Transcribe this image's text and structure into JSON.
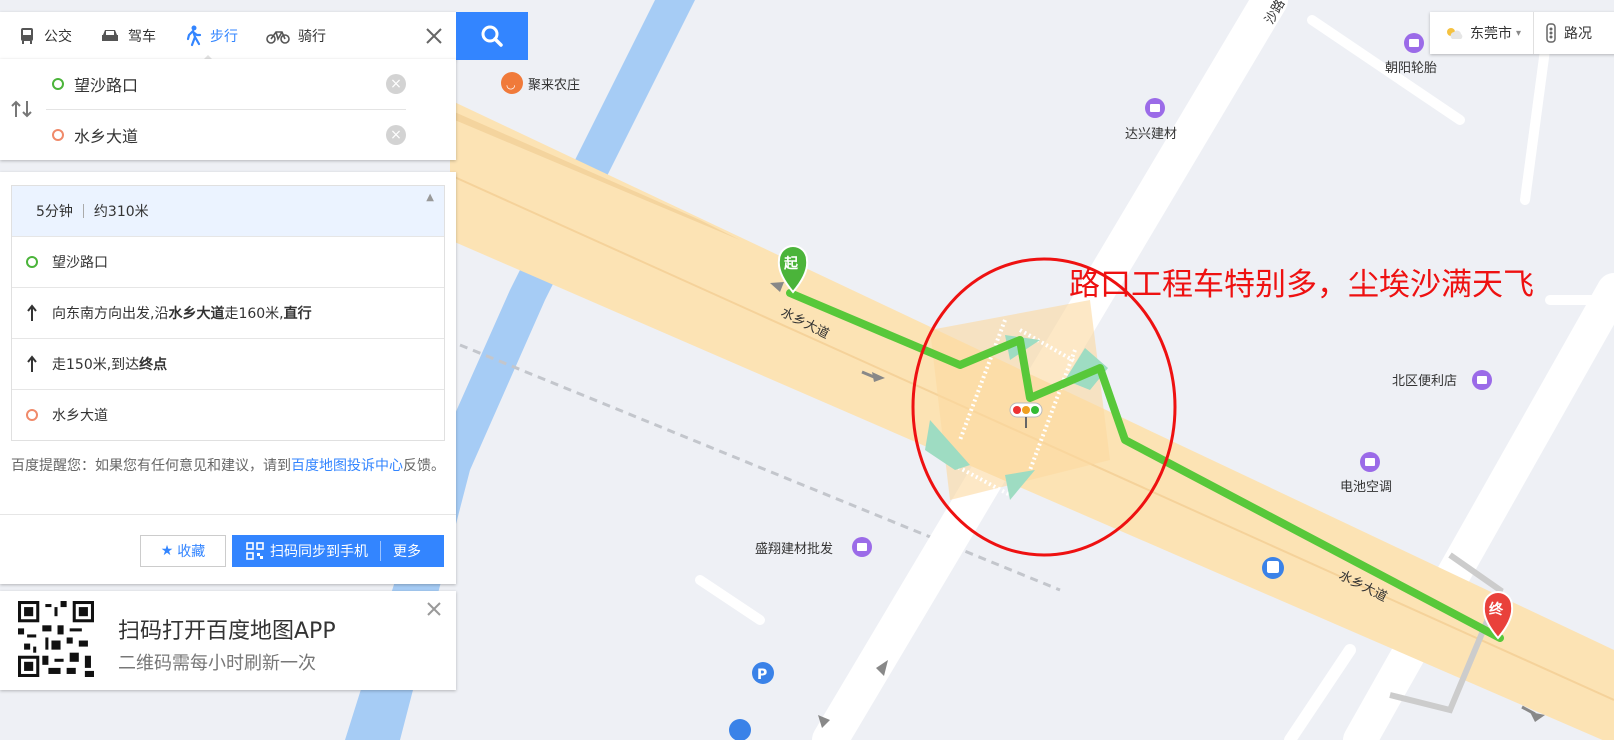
{
  "mode_tabs": {
    "bus": "公交",
    "drive": "驾车",
    "walk": "步行",
    "bike": "骑行"
  },
  "route": {
    "start": "望沙路口",
    "end": "水乡大道",
    "clear_icon": "×"
  },
  "summary": {
    "duration": "5分钟",
    "distance": "约310米"
  },
  "steps": [
    {
      "pre": "望沙路口",
      "bold": "",
      "post": "",
      "bold2": ""
    },
    {
      "pre": "向东南方向出发,沿",
      "bold": "水乡大道",
      "post": "走160米,",
      "bold2": "直行"
    },
    {
      "pre": "走150米,到达",
      "bold": "终点",
      "post": "",
      "bold2": ""
    },
    {
      "pre": "水乡大道",
      "bold": "",
      "post": "",
      "bold2": ""
    }
  ],
  "tip": {
    "prefix": "百度提醒您：如果您有任何意见和建议，请到",
    "link": "百度地图投诉中心",
    "suffix": "反馈。"
  },
  "buttons": {
    "favorite": "收藏",
    "sync": "扫码同步到手机",
    "more": "更多"
  },
  "qr": {
    "title": "扫码打开百度地图APP",
    "subtitle": "二维码需每小时刷新一次"
  },
  "top_right": {
    "city": "东莞市",
    "traffic": "路况"
  },
  "map": {
    "road_labels": [
      "水乡大道",
      "水乡大道",
      "沙路"
    ],
    "pois": [
      "聚来农庄",
      "达兴建材",
      "朝阳轮胎",
      "北区便利店",
      "电池空调",
      "盛翔建材批发"
    ],
    "start_marker": "起",
    "end_marker": "终",
    "annotation": "路口工程车特别多，尘埃沙满天飞",
    "route_color": "#58c83a",
    "annotation_color": "#ee1111"
  },
  "colors": {
    "accent": "#3385ff",
    "road": "#fce3b4",
    "water": "#a6ccf5",
    "background": "#eef0f5"
  }
}
